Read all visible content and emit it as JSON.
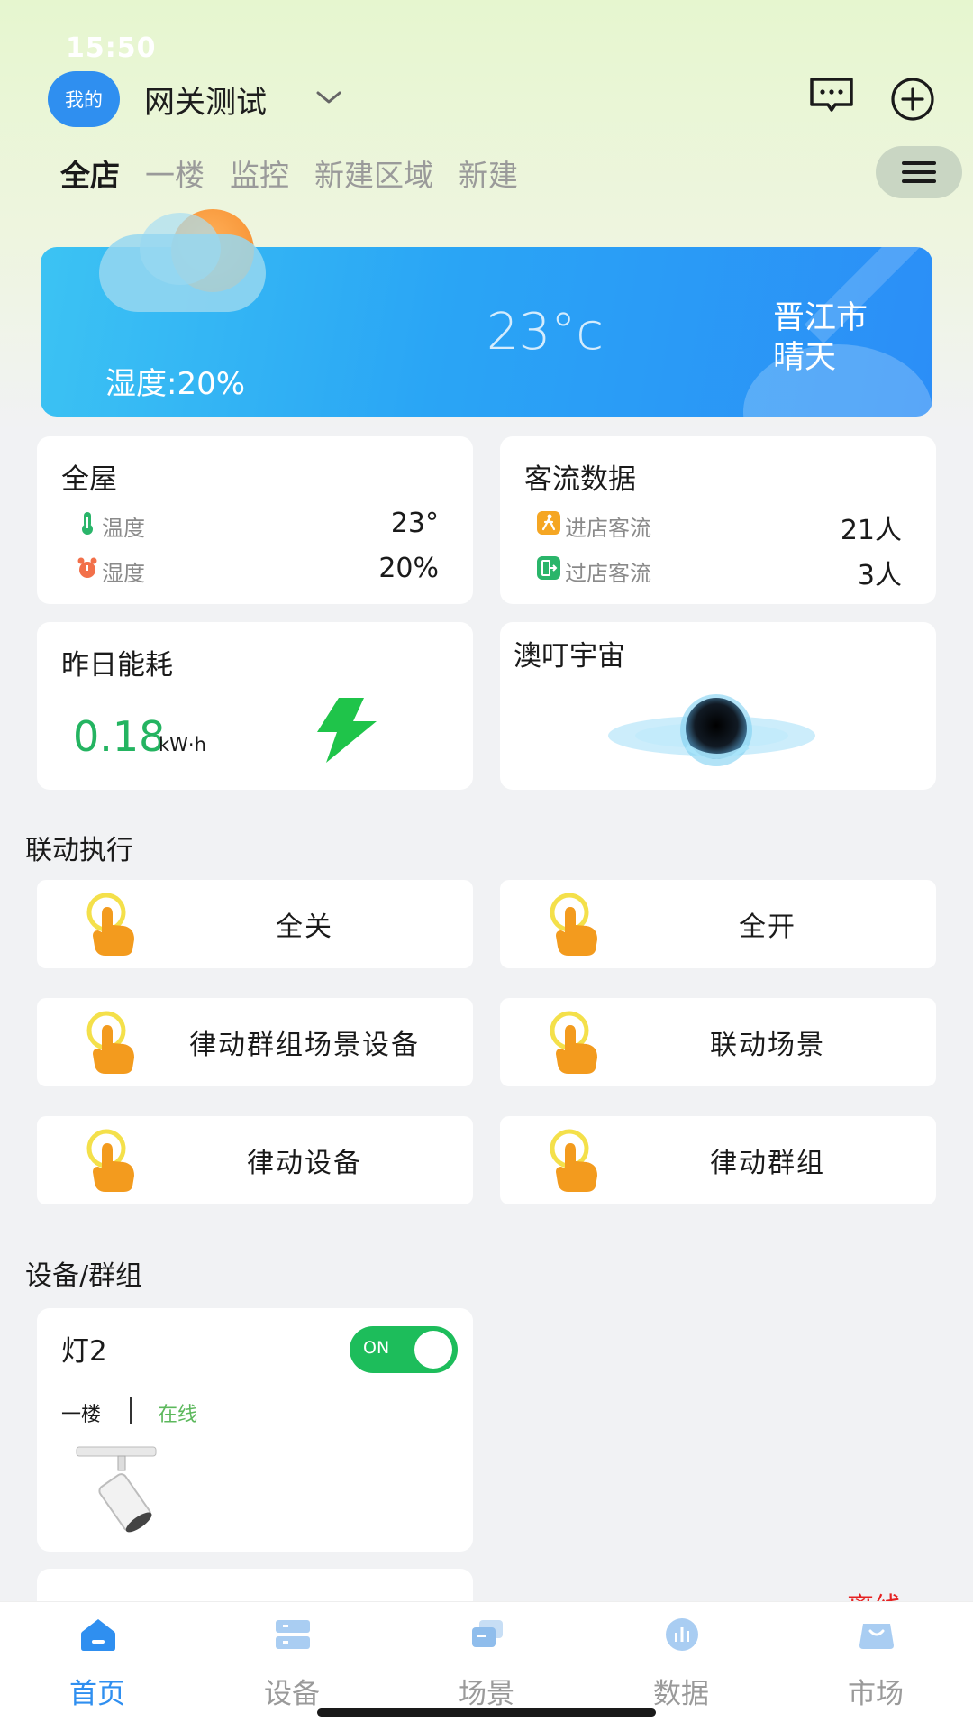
{
  "status_bar": {
    "time": "15:50"
  },
  "header": {
    "avatar_label": "我的",
    "home_name": "网关测试"
  },
  "area_tabs": [
    {
      "label": "全店",
      "active": true
    },
    {
      "label": "一楼",
      "active": false
    },
    {
      "label": "监控",
      "active": false
    },
    {
      "label": "新建区域",
      "active": false
    },
    {
      "label": "新建",
      "active": false
    }
  ],
  "weather": {
    "humidity": "湿度:20%",
    "temperature": "23°c",
    "city": "晋江市",
    "condition": "晴天"
  },
  "whole_house": {
    "title": "全屋",
    "temp_label": "温度",
    "temp_value": "23°",
    "humidity_label": "湿度",
    "humidity_value": "20%"
  },
  "traffic": {
    "title": "客流数据",
    "in_label": "进店客流",
    "in_value": "21人",
    "pass_label": "过店客流",
    "pass_value": "3人"
  },
  "energy": {
    "title": "昨日能耗",
    "value": "0.18",
    "unit": "kW·h"
  },
  "universe": {
    "title": "澳叮宇宙"
  },
  "linkage": {
    "section_title": "联动执行",
    "actions": [
      "全关",
      "全开",
      "律动群组场景设备",
      "联动场景",
      "律动设备",
      "律动群组"
    ]
  },
  "devices": {
    "section_title": "设备/群组",
    "items": [
      {
        "name": "灯2",
        "toggle": "ON",
        "area": "一楼",
        "status": "在线"
      }
    ],
    "partial_status": "离线"
  },
  "bottom_nav": [
    {
      "label": "首页",
      "icon": "home-icon",
      "active": true
    },
    {
      "label": "设备",
      "icon": "device-icon",
      "active": false
    },
    {
      "label": "场景",
      "icon": "scene-icon",
      "active": false
    },
    {
      "label": "数据",
      "icon": "data-icon",
      "active": false
    },
    {
      "label": "市场",
      "icon": "market-icon",
      "active": false
    }
  ],
  "colors": {
    "accent": "#2f8ff0",
    "energy_green": "#24b461",
    "toggle_on": "#1dbd5b",
    "online_green": "#5cb85c",
    "offline_red": "#e52222"
  }
}
